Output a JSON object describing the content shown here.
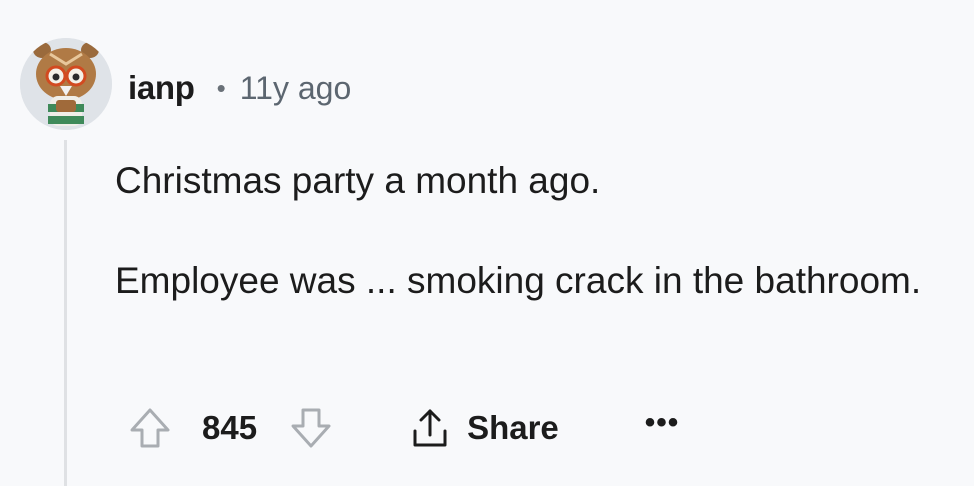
{
  "comment": {
    "author": "ianp",
    "separator": "•",
    "age": "11y ago",
    "paragraphs": [
      "Christmas party a month ago.",
      "Employee was ... smoking crack in the bathroom."
    ]
  },
  "actions": {
    "upvote_icon": "arrow-up-outline-icon",
    "score": "845",
    "downvote_icon": "arrow-down-outline-icon",
    "share_icon": "share-upload-icon",
    "share_label": "Share",
    "more_label": "•••"
  },
  "avatar": {
    "icon": "snoo-owl-avatar-icon"
  },
  "colors": {
    "background": "#f8f9fb",
    "text": "#1c1c1c",
    "muted": "#5c6670",
    "thread_line": "#dfe1e4",
    "vote_icon": "#a9adb2"
  }
}
